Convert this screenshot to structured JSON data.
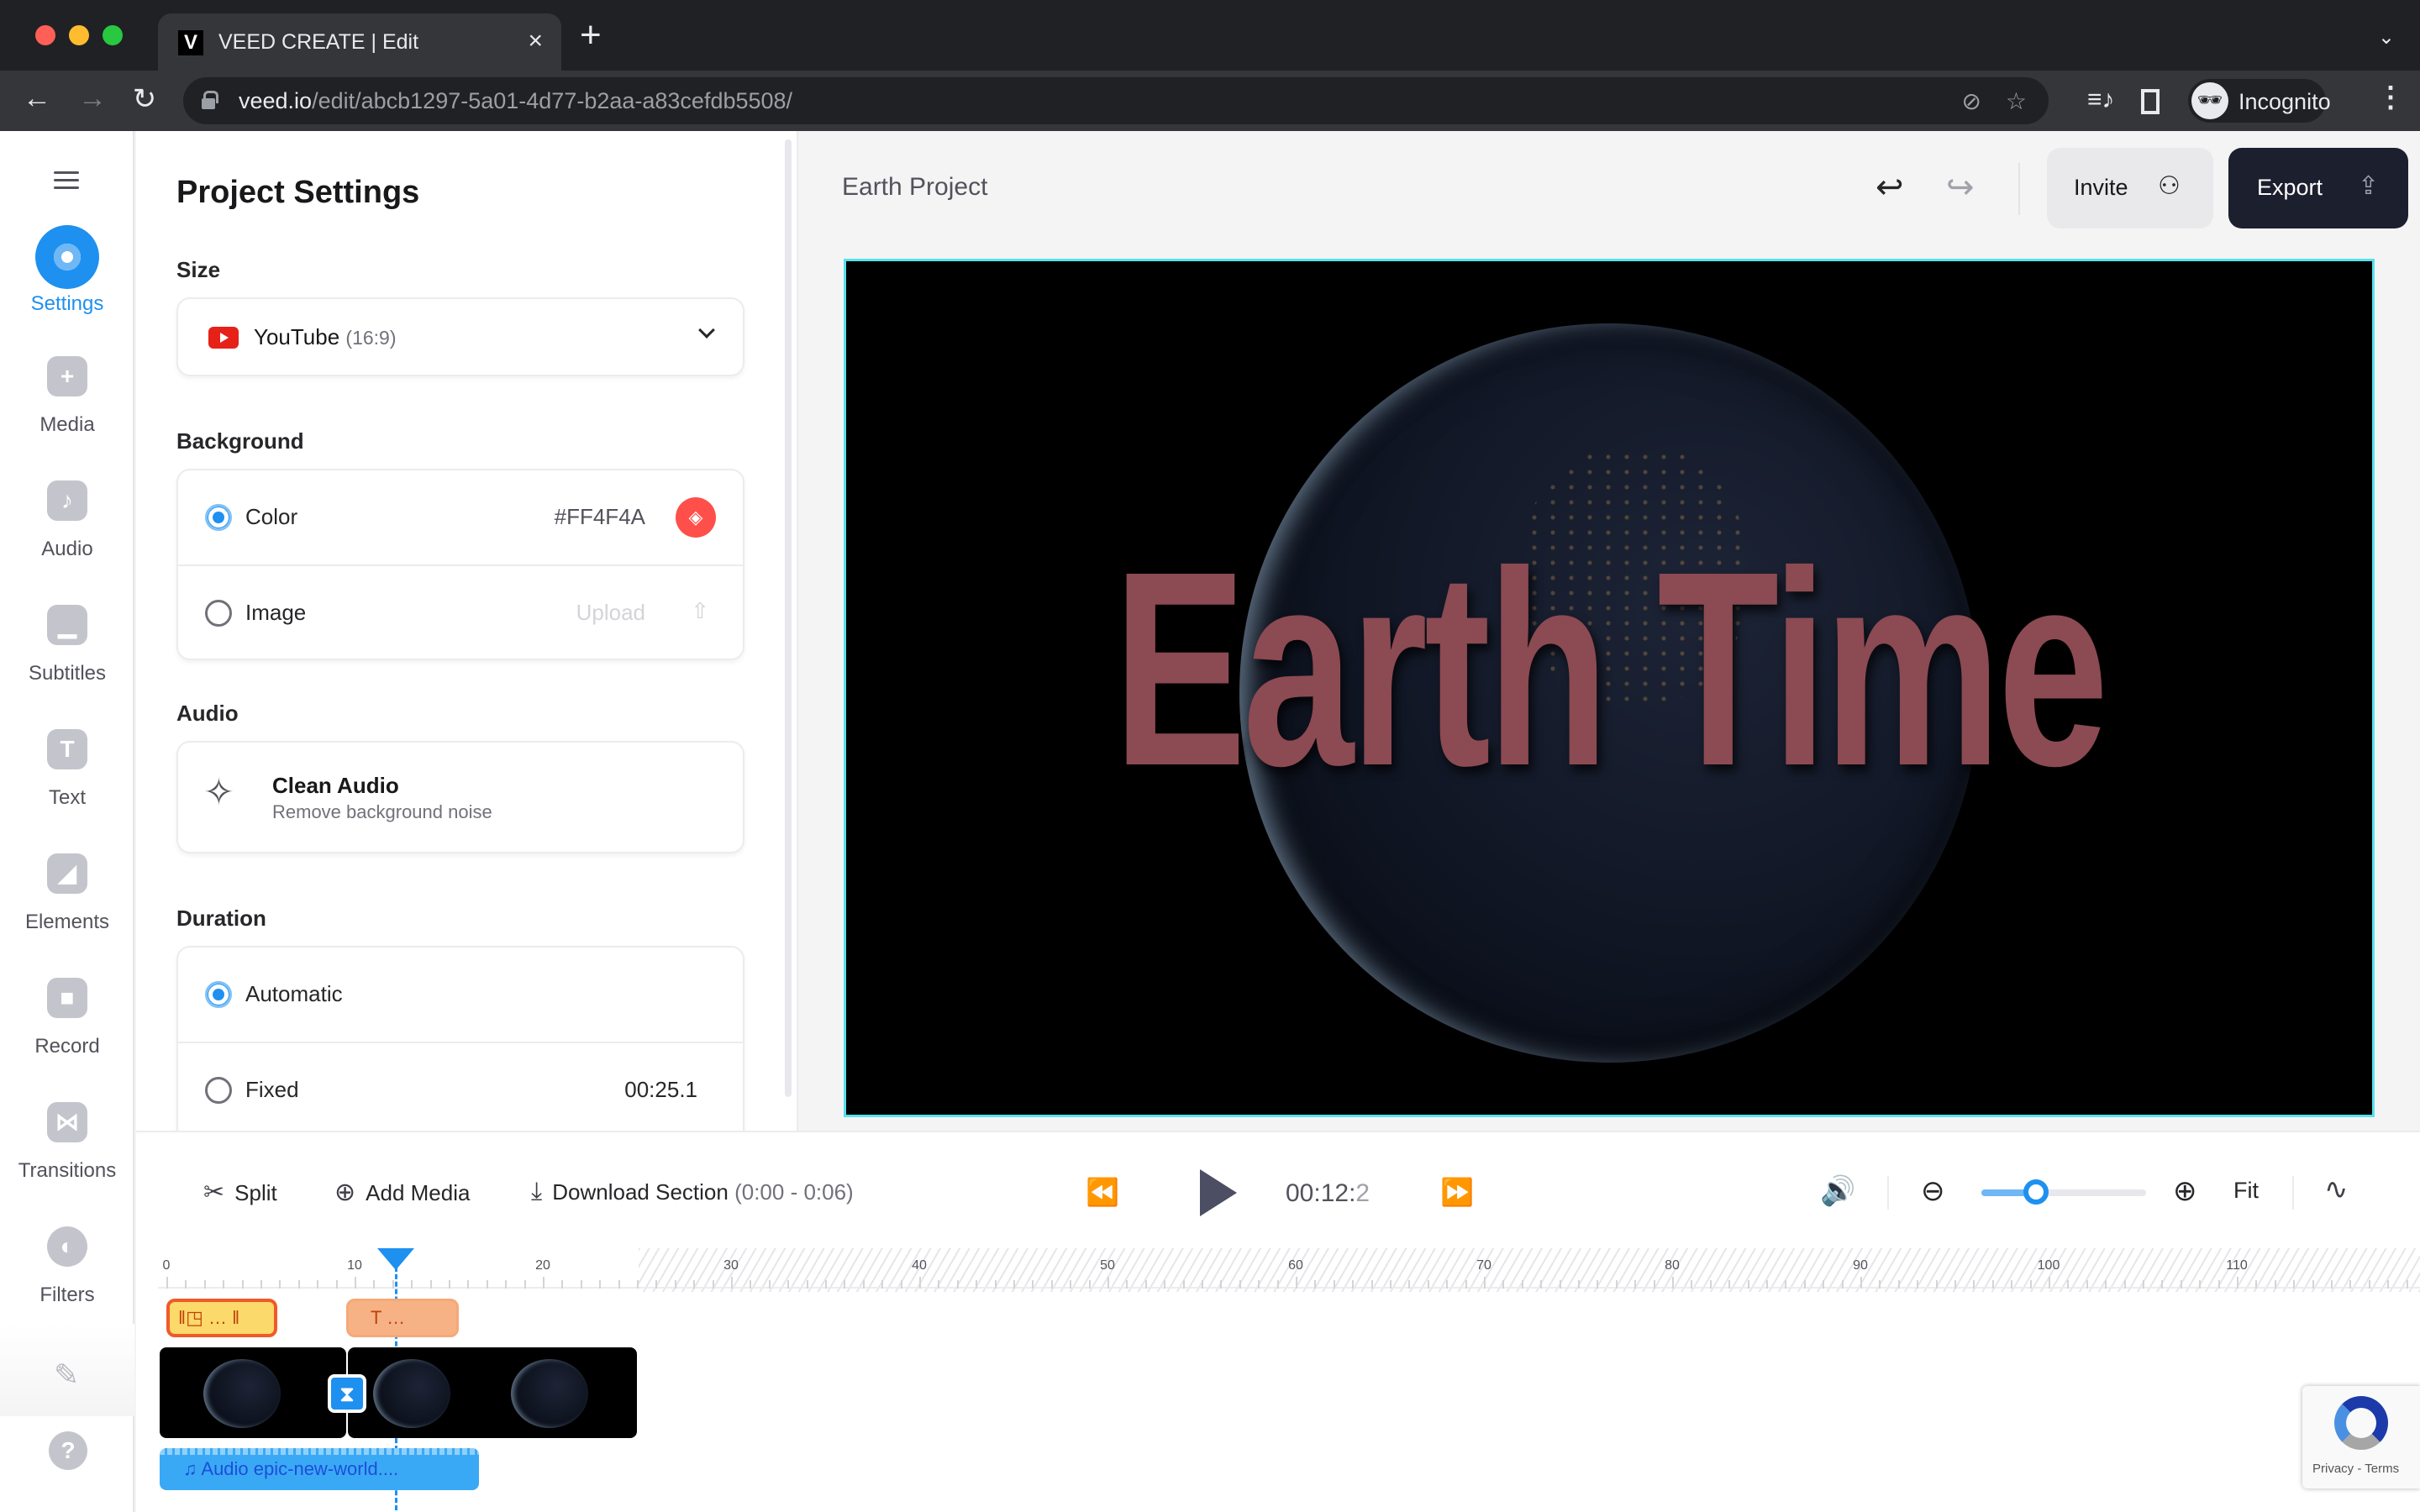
{
  "browser": {
    "tab_title": "VEED CREATE | Edit",
    "favicon_letter": "V",
    "close_tab": "×",
    "new_tab": "+",
    "tabs_menu": "⌄",
    "url_host": "veed.io",
    "url_path": "/edit/abcb1297-5a01-4d77-b2aa-a83cefdb5508/",
    "profile_label": "Incognito",
    "icons": {
      "back": "←",
      "forward": "→",
      "reload": "↻",
      "eye_off": "⊘",
      "bookmark": "☆",
      "media_control": "≡♪",
      "menu": "⋮",
      "incognito": "🕶"
    }
  },
  "sidebar": {
    "items": [
      {
        "label": "Settings",
        "icon": "gear-icon",
        "glyph": "",
        "active": true
      },
      {
        "label": "Media",
        "icon": "plus-icon",
        "glyph": "+"
      },
      {
        "label": "Audio",
        "icon": "music-note-icon",
        "glyph": "♪"
      },
      {
        "label": "Subtitles",
        "icon": "subtitles-icon",
        "glyph": "▁"
      },
      {
        "label": "Text",
        "icon": "text-icon",
        "glyph": "T"
      },
      {
        "label": "Elements",
        "icon": "sticker-icon",
        "glyph": "◢"
      },
      {
        "label": "Record",
        "icon": "camera-icon",
        "glyph": "■"
      },
      {
        "label": "Transitions",
        "icon": "bowtie-icon",
        "glyph": "⋈"
      },
      {
        "label": "Filters",
        "icon": "half-circle-icon",
        "glyph": "◐"
      }
    ],
    "pen_glyph": "✎",
    "help_glyph": "?"
  },
  "settings": {
    "title": "Project Settings",
    "size": {
      "label": "Size",
      "value": "YouTube",
      "ratio": "(16:9)"
    },
    "background": {
      "label": "Background",
      "options": [
        {
          "label": "Color",
          "value": "#FF4F4A",
          "checked": true
        },
        {
          "label": "Image",
          "value": "Upload",
          "checked": false
        }
      ],
      "color_hex": "#FF4F4A",
      "fill_glyph": "◈",
      "upload_glyph": "⇧"
    },
    "audio": {
      "label": "Audio",
      "clean_title": "Clean Audio",
      "clean_subtitle": "Remove background noise",
      "star_glyph": "✧"
    },
    "duration": {
      "label": "Duration",
      "options": [
        {
          "label": "Automatic",
          "checked": true
        },
        {
          "label": "Fixed",
          "value": "00:25.1",
          "checked": false
        }
      ]
    }
  },
  "header": {
    "project_name": "Earth Project",
    "undo_glyph": "↩",
    "redo_glyph": "↪",
    "invite_label": "Invite",
    "invite_glyph": "⚇",
    "export_label": "Export",
    "export_glyph": "⇪"
  },
  "canvas": {
    "overlay_text": "Earth Time",
    "overlay_color": "#8C4A52",
    "border_color": "#57E1EC"
  },
  "timeline": {
    "tools": {
      "split_label": "Split",
      "split_glyph": "✂",
      "add_media_label": "Add Media",
      "add_media_glyph": "⊕",
      "download_label": "Download Section",
      "download_range": "(0:00 - 0:06)",
      "download_glyph": "⤓"
    },
    "transport": {
      "skip_back_glyph": "⏪",
      "skip_forward_glyph": "⏩",
      "timecode_main": "00:12:",
      "timecode_frac": "2"
    },
    "zoom": {
      "volume_glyph": "🔊",
      "zoom_out_glyph": "⊖",
      "zoom_in_glyph": "⊕",
      "fit_label": "Fit",
      "waveform_glyph": "∿",
      "level": 0.33
    },
    "ruler": {
      "labels": [
        "0",
        "10",
        "20",
        "30",
        "40",
        "50",
        "60",
        "70",
        "80",
        "90",
        "100",
        "110"
      ],
      "max_seconds": 120,
      "playhead_seconds": 12.2,
      "project_end_seconds": 25.1
    },
    "tracks": {
      "element_clip_label": "‖◳ …  ‖",
      "text_clip_label": "T …",
      "transition_glyph": "⧗",
      "audio_clip_label": "♫ Audio epic-new-world...."
    }
  },
  "recaptcha": {
    "links": "Privacy - Terms"
  }
}
